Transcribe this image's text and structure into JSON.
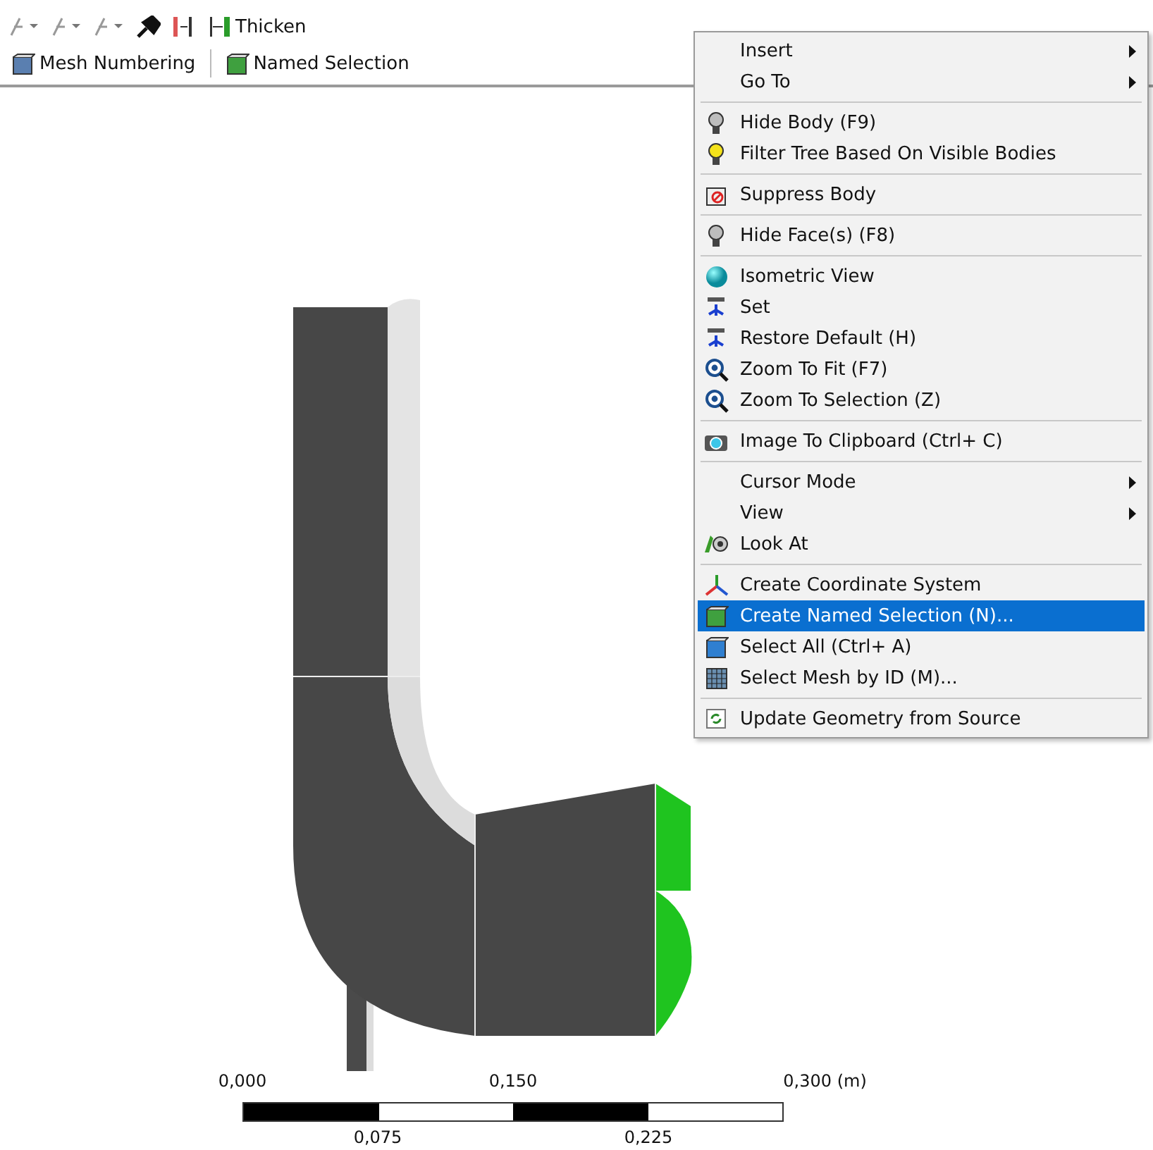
{
  "toolbar_top": {
    "buttons": [
      {
        "label": "Thicken"
      }
    ]
  },
  "toolbar_bottom": {
    "buttons": [
      {
        "label": "Mesh Numbering"
      },
      {
        "label": "Named Selection"
      }
    ]
  },
  "context_menu": {
    "groups": [
      {
        "items": [
          {
            "label": "Insert",
            "has_submenu": true,
            "selected": false
          },
          {
            "label": "Go To",
            "has_submenu": true,
            "selected": false
          }
        ]
      },
      {
        "items": [
          {
            "label": "Hide Body (F9)",
            "has_submenu": false,
            "selected": false
          },
          {
            "label": "Filter Tree Based On Visible Bodies",
            "has_submenu": false,
            "selected": false
          }
        ]
      },
      {
        "items": [
          {
            "label": "Suppress Body",
            "has_submenu": false,
            "selected": false
          }
        ]
      },
      {
        "items": [
          {
            "label": "Hide Face(s) (F8)",
            "has_submenu": false,
            "selected": false
          }
        ]
      },
      {
        "items": [
          {
            "label": "Isometric View",
            "has_submenu": false,
            "selected": false
          },
          {
            "label": "Set",
            "has_submenu": false,
            "selected": false
          },
          {
            "label": "Restore Default (H)",
            "has_submenu": false,
            "selected": false
          },
          {
            "label": "Zoom To Fit (F7)",
            "has_submenu": false,
            "selected": false
          },
          {
            "label": "Zoom To Selection (Z)",
            "has_submenu": false,
            "selected": false
          }
        ]
      },
      {
        "items": [
          {
            "label": "Image To Clipboard (Ctrl+ C)",
            "has_submenu": false,
            "selected": false
          }
        ]
      },
      {
        "items": [
          {
            "label": "Cursor Mode",
            "has_submenu": true,
            "selected": false
          },
          {
            "label": "View",
            "has_submenu": true,
            "selected": false
          },
          {
            "label": "Look At",
            "has_submenu": false,
            "selected": false
          }
        ]
      },
      {
        "items": [
          {
            "label": "Create Coordinate System",
            "has_submenu": false,
            "selected": false
          },
          {
            "label": "Create Named Selection (N)...",
            "has_submenu": false,
            "selected": true
          },
          {
            "label": "Select All (Ctrl+ A)",
            "has_submenu": false,
            "selected": false
          },
          {
            "label": "Select Mesh by ID (M)...",
            "has_submenu": false,
            "selected": false
          }
        ]
      },
      {
        "items": [
          {
            "label": "Update Geometry from Source",
            "has_submenu": false,
            "selected": false
          }
        ]
      }
    ]
  },
  "scale_bar": {
    "top_labels": [
      "0,000",
      "0,150",
      "0,300"
    ],
    "unit": "(m)",
    "bottom_labels": [
      "0,075",
      "0,225"
    ]
  }
}
